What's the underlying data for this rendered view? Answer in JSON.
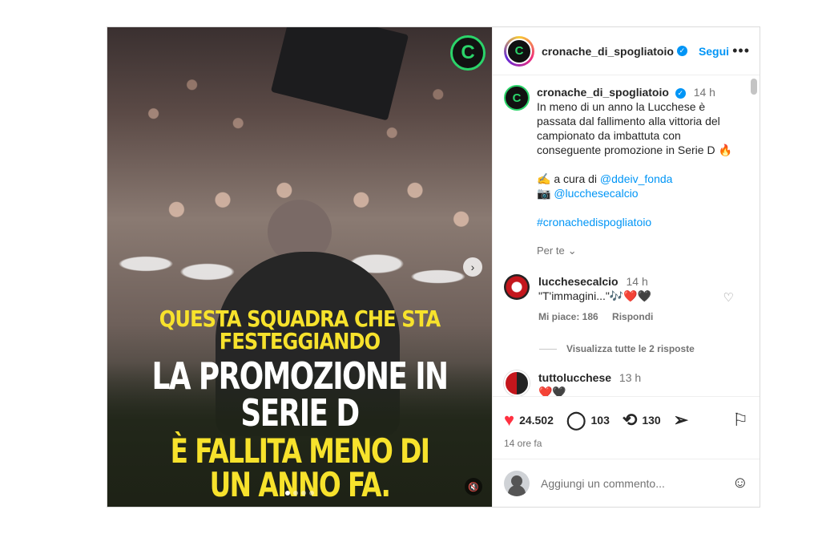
{
  "account": {
    "username": "cronache_di_spogliatoio",
    "follow": "Segui",
    "more": "•••",
    "verified": "✓",
    "logo": "C"
  },
  "media": {
    "caption_lines": [
      "QUESTA SQUADRA CHE STA FESTEGGIANDO",
      "LA PROMOZIONE IN SERIE D",
      "È FALLITA MENO DI UN ANNO FA."
    ],
    "next": "›",
    "mute": "🔇",
    "dots_count": 4,
    "active_dot": 0,
    "caption_colors": {
      "yellow": "#f7e22c",
      "white": "#ffffff"
    }
  },
  "post_caption": {
    "username": "cronache_di_spogliatoio",
    "time": "14 h",
    "text": "In meno di un anno la Lucchese è passata dal fallimento alla vittoria del campionato da imbattuta con conseguente promozione in Serie D 🔥",
    "credit_prefix": "✍️ a cura di",
    "credit_handle": "@ddeiv_fonda",
    "photo_prefix": "📷",
    "photo_handle": "@lucchesecalcio",
    "hashtag": "#cronachedispogliatoio",
    "see_translation": "Per te"
  },
  "comments": [
    {
      "username": "lucchesecalcio",
      "time": "14 h",
      "text": "\"T'immagini...\"🎶❤️🖤",
      "likes": "Mi piace: 186",
      "reply": "Rispondi",
      "view_replies": "Visualizza tutte le 2 risposte"
    },
    {
      "username": "tuttolucchese",
      "time": "13 h",
      "text": "❤️🖤"
    }
  ],
  "actions": {
    "likes": "24.502",
    "comments": "103",
    "reposts": "130"
  },
  "time_ago": "14 ore fa",
  "add_comment": {
    "placeholder": "Aggiungi un commento..."
  },
  "colors": {
    "accent": "#0095f6",
    "like": "#ff3040",
    "brand_green": "#2bd46a"
  }
}
